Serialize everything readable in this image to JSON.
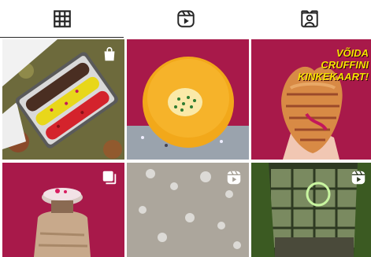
{
  "tabs": [
    {
      "name": "grid",
      "icon": "grid-icon",
      "active": true
    },
    {
      "name": "reels",
      "icon": "reels-icon",
      "active": false
    },
    {
      "name": "tagged",
      "icon": "tagged-user-icon",
      "active": false
    }
  ],
  "posts": [
    {
      "subject": "eclairs",
      "badge": "shopping-bag-icon"
    },
    {
      "subject": "bun",
      "badge": null
    },
    {
      "subject": "cruffin",
      "badge": null,
      "caption": [
        "VÕIDA",
        "CRUFFINI",
        "KINKEKAART!"
      ]
    },
    {
      "subject": "cake",
      "badge": "carousel-icon"
    },
    {
      "subject": "flour",
      "badge": "reels-icon"
    },
    {
      "subject": "window",
      "badge": "reels-icon"
    }
  ],
  "colors": {
    "magenta": "#a8194a",
    "dark_text": "#262626",
    "caption_yellow": "#f5e300"
  }
}
